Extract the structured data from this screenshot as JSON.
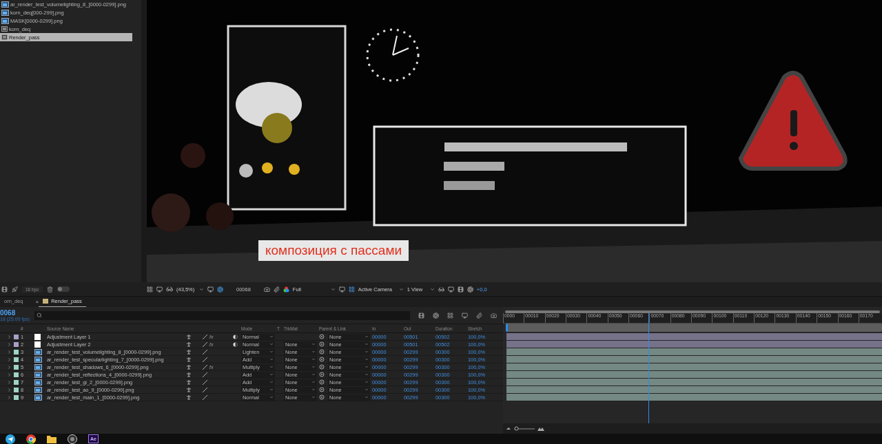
{
  "project": {
    "items": [
      {
        "name": "ar_render_test_volumelighting_8_[0000-0299].png",
        "kind": "footage",
        "selected": false
      },
      {
        "name": "korn_deq[000-299].png",
        "kind": "footage",
        "selected": false
      },
      {
        "name": "MASK[0000-0299].png",
        "kind": "footage",
        "selected": false
      },
      {
        "name": "korn_deq",
        "kind": "composition",
        "selected": false
      },
      {
        "name": "Render_pass",
        "kind": "composition",
        "selected": true
      }
    ],
    "depth": "16 bpc",
    "toggle_on": false
  },
  "viewer": {
    "caption": "композиция с пассами",
    "zoom": "(43,5%)",
    "frame": "00068",
    "resolution": "Full",
    "camera": "Active Camera",
    "views": "1 View",
    "exposure": "+0,0"
  },
  "timeline": {
    "tabs": [
      {
        "label": "orn_deq",
        "selected": false
      },
      {
        "label": "Render_pass",
        "selected": true
      }
    ],
    "close": "×",
    "timecode": "0068",
    "fps": "18 (25.00 fps)",
    "zoom": {
      "level": 0.1
    },
    "columns": {
      "number": "#",
      "source": "Source Name",
      "mode": "Mode",
      "t": "T",
      "trkmat": "TrkMat",
      "parent": "Parent & Link",
      "in": "In",
      "out": "Out",
      "duration": "Duration",
      "stretch": "Stretch"
    },
    "layers": [
      {
        "number": "1",
        "name": "Adjustment Layer 1",
        "kind": "adjustment",
        "color": "#a9a0c8",
        "fx": "fx",
        "mode": "Normal",
        "in": "00000",
        "out": "00501",
        "duration": "00502",
        "stretch": "100,0%",
        "parent": "None"
      },
      {
        "number": "2",
        "name": "Adjustment Layer 2",
        "kind": "adjustment",
        "color": "#a9a0c8",
        "fx": "fx",
        "mode": "Normal",
        "trkmat": "None",
        "in": "00000",
        "out": "00501",
        "duration": "00502",
        "stretch": "100,0%",
        "parent": "None"
      },
      {
        "number": "3",
        "name": "ar_render_test_volumelighting_8_[0000-0299].png",
        "kind": "footage",
        "color": "#9ed4c6",
        "mode": "Lighten",
        "trkmat": "None",
        "in": "00000",
        "out": "00299",
        "duration": "00300",
        "stretch": "100,0%",
        "parent": "None"
      },
      {
        "number": "4",
        "name": "ar_render_test_specularlighting_7_[0000-0299].png",
        "kind": "footage",
        "color": "#9ed4c6",
        "mode": "Add",
        "trkmat": "None",
        "in": "00000",
        "out": "00299",
        "duration": "00300",
        "stretch": "100,0%",
        "parent": "None"
      },
      {
        "number": "5",
        "name": "ar_render_test_shadows_6_[0000-0299].png",
        "kind": "footage",
        "color": "#9ed4c6",
        "fx": "fx",
        "mode": "Multiply",
        "trkmat": "None",
        "in": "00000",
        "out": "00299",
        "duration": "00300",
        "stretch": "100,0%",
        "parent": "None"
      },
      {
        "number": "6",
        "name": "ar_render_test_reflections_4_[0000-0299].png",
        "kind": "footage",
        "color": "#9ed4c6",
        "mode": "Add",
        "trkmat": "None",
        "in": "00000",
        "out": "00299",
        "duration": "00300",
        "stretch": "100,0%",
        "parent": "None"
      },
      {
        "number": "7",
        "name": "ar_render_test_gi_2_[0000-0299].png",
        "kind": "footage",
        "color": "#9ed4c6",
        "mode": "Add",
        "trkmat": "None",
        "in": "00000",
        "out": "00299",
        "duration": "00300",
        "stretch": "100,0%",
        "parent": "None"
      },
      {
        "number": "8",
        "name": "ar_render_test_ao_9_[0000-0299].png",
        "kind": "footage",
        "color": "#9ed4c6",
        "mode": "Multiply",
        "trkmat": "None",
        "in": "00000",
        "out": "00299",
        "duration": "00300",
        "stretch": "100,0%",
        "parent": "None"
      },
      {
        "number": "9",
        "name": "ar_render_test_main_1_[0000-0299].png",
        "kind": "footage",
        "color": "#9ed4c6",
        "mode": "Normal",
        "trkmat": "None",
        "in": "00000",
        "out": "00299",
        "duration": "00300",
        "stretch": "100,0%",
        "parent": "None"
      }
    ],
    "ruler": [
      "0000",
      "00010",
      "00020",
      "00030",
      "00040",
      "00050",
      "00060",
      "00070",
      "00080",
      "00090",
      "00100",
      "00110",
      "00120",
      "00130",
      "00140",
      "00150",
      "00160",
      "00170"
    ],
    "playhead": {
      "level": 0.375
    }
  },
  "taskbar": {
    "apps": [
      {
        "kind": "telegram"
      },
      {
        "kind": "chrome"
      },
      {
        "kind": "folder"
      },
      {
        "kind": "obs"
      },
      {
        "kind": "aftereffects",
        "label": "Ae"
      }
    ]
  }
}
